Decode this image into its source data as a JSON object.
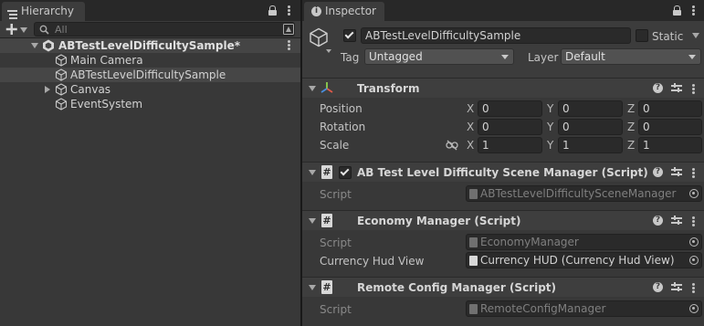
{
  "hierarchy": {
    "tab_label": "Hierarchy",
    "search_placeholder": "All",
    "scene": {
      "name": "ABTestLevelDifficultySample*"
    },
    "items": [
      {
        "label": "Main Camera",
        "selected": false,
        "expandable": false
      },
      {
        "label": "ABTestLevelDifficultySample",
        "selected": true,
        "expandable": false
      },
      {
        "label": "Canvas",
        "selected": false,
        "expandable": true
      },
      {
        "label": "EventSystem",
        "selected": false,
        "expandable": false
      }
    ]
  },
  "inspector": {
    "tab_label": "Inspector",
    "object": {
      "name": "ABTestLevelDifficultySample",
      "active": true,
      "static_label": "Static",
      "static": false,
      "tag_label": "Tag",
      "tag_value": "Untagged",
      "layer_label": "Layer",
      "layer_value": "Default"
    },
    "transform": {
      "title": "Transform",
      "rows": [
        {
          "label": "Position",
          "x": "0",
          "y": "0",
          "z": "0"
        },
        {
          "label": "Rotation",
          "x": "0",
          "y": "0",
          "z": "0"
        },
        {
          "label": "Scale",
          "x": "1",
          "y": "1",
          "z": "1"
        }
      ],
      "axis_labels": {
        "x": "X",
        "y": "Y",
        "z": "Z"
      }
    },
    "components": [
      {
        "title": "AB Test Level Difficulty Scene Manager (Script)",
        "enabled": true,
        "has_checkbox": true,
        "properties": [
          {
            "label": "Script",
            "value": "ABTestLevelDifficultySceneManager",
            "readonly": true
          }
        ]
      },
      {
        "title": "Economy Manager (Script)",
        "has_checkbox": false,
        "properties": [
          {
            "label": "Script",
            "value": "EconomyManager",
            "readonly": true
          },
          {
            "label": "Currency Hud View",
            "value": "Currency HUD (Currency Hud View)",
            "readonly": false
          }
        ]
      },
      {
        "title": "Remote Config Manager (Script)",
        "has_checkbox": false,
        "properties": [
          {
            "label": "Script",
            "value": "RemoteConfigManager",
            "readonly": true
          }
        ]
      }
    ],
    "icons": {
      "help": "?",
      "script": "#",
      "info": "i"
    }
  },
  "colors": {
    "panel_bg": "#383838",
    "header_bg": "#3e3e3e",
    "field_bg": "#2a2a2a",
    "selected_row": "#464646"
  }
}
